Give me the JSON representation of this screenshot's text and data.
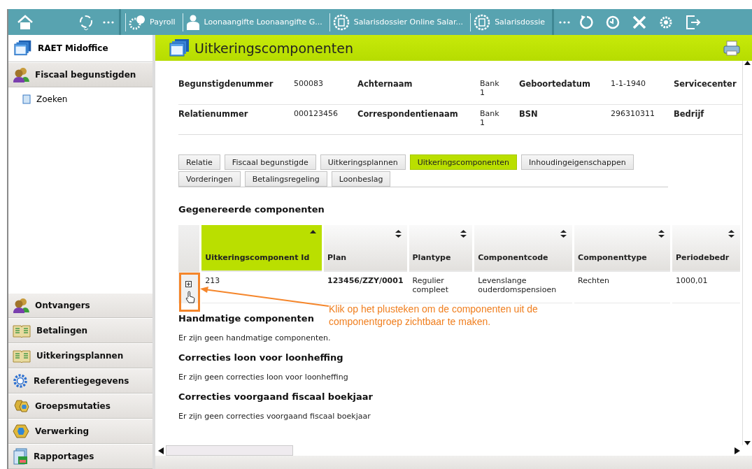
{
  "top_bar": {
    "apps": [
      {
        "label": "Payroll"
      },
      {
        "label": "Loonaangifte Loonaangifte G..."
      },
      {
        "label": "Salarisdossier Online Salar..."
      },
      {
        "label": "Salarisdossie"
      }
    ]
  },
  "sidebar": {
    "header": "RAET Midoffice",
    "sections": [
      {
        "label": "Fiscaal begunstigden",
        "children": [
          "Zoeken"
        ]
      },
      {
        "label": "Ontvangers"
      },
      {
        "label": "Betalingen"
      },
      {
        "label": "Uitkeringsplannen"
      },
      {
        "label": "Referentiegegevens"
      },
      {
        "label": "Groepsmutaties"
      },
      {
        "label": "Verwerking"
      },
      {
        "label": "Rapportages"
      }
    ]
  },
  "page": {
    "title": "Uitkeringscomponenten",
    "info_rows": [
      [
        "Begunstigdenummer",
        "500083",
        "Achternaam",
        "Bank 1",
        "Geboortedatum",
        "1-1-1940",
        "Servicecenter"
      ],
      [
        "Relatienummer",
        "000123456",
        "Correspondentienaam",
        "Bank 1",
        "BSN",
        "296310311",
        "Bedrijf"
      ]
    ],
    "tabs": [
      {
        "label": "Relatie",
        "selected": false
      },
      {
        "label": "Fiscaal begunstigde",
        "selected": false
      },
      {
        "label": "Uitkeringsplannen",
        "selected": false
      },
      {
        "label": "Uitkeringscomponenten",
        "selected": true
      },
      {
        "label": "Inhoudingeigenschappen",
        "selected": false
      },
      {
        "label": "Vorderingen",
        "selected": false
      },
      {
        "label": "Betalingsregeling",
        "selected": false
      },
      {
        "label": "Loonbeslag",
        "selected": false
      }
    ],
    "generated": {
      "heading": "Gegenereerde componenten",
      "table": {
        "columns": [
          {
            "label": "Uitkeringscomponent Id",
            "selected": true
          },
          {
            "label": "Plan",
            "selected": false
          },
          {
            "label": "Plantype",
            "selected": false
          },
          {
            "label": "Componentcode",
            "selected": false
          },
          {
            "label": "Componenttype",
            "selected": false
          },
          {
            "label": "Periodebedr",
            "selected": false
          }
        ],
        "rows": [
          {
            "expanded": false,
            "cells": [
              "213",
              "123456/ZZY/0001",
              "Regulier compleet",
              "Levenslange ouderdomspensioen",
              "Rechten",
              "1000,01"
            ]
          }
        ]
      }
    },
    "sections": [
      {
        "heading": "Handmatige componenten",
        "text": "Er zijn geen handmatige componenten."
      },
      {
        "heading": "Correcties loon voor loonheffing",
        "text": "Er zijn geen correcties loon voor loonheffing"
      },
      {
        "heading": "Correcties voorgaand fiscaal boekjaar",
        "text": "Er zijn geen correcties voorgaand fiscaal boekjaar"
      }
    ],
    "annotation": "Klik op het plusteken om de componenten uit de componentgroep zichtbaar te maken."
  }
}
